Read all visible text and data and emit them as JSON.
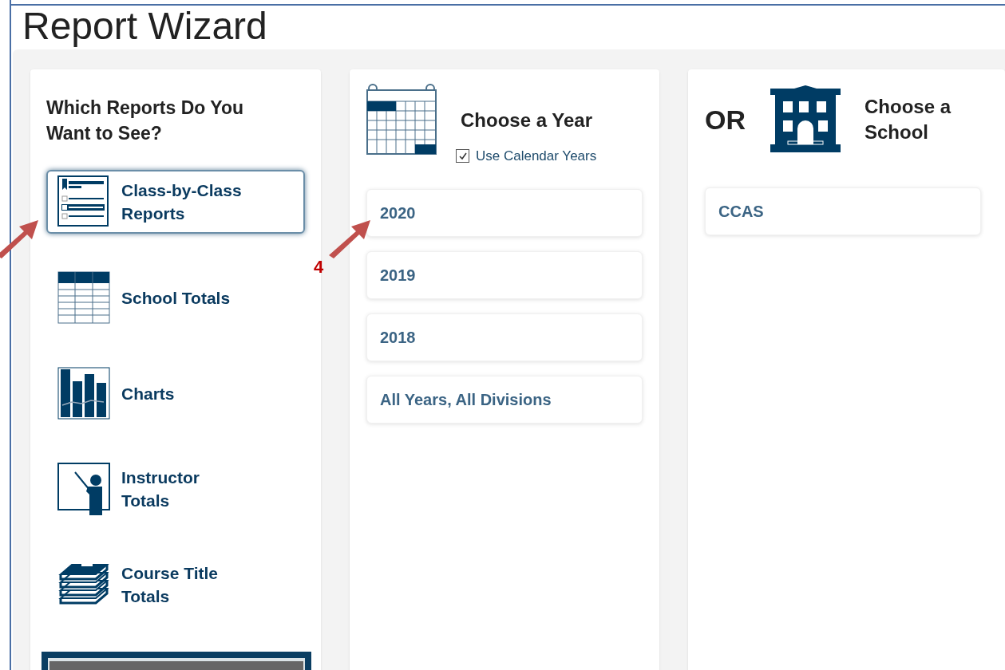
{
  "title": "Report Wizard",
  "reports": {
    "heading": "Which Reports Do You Want to See?",
    "items": [
      {
        "label": "Class-by-Class Reports",
        "kind": "checklist",
        "selected": true
      },
      {
        "label": "School Totals",
        "kind": "table",
        "selected": false
      },
      {
        "label": "Charts",
        "kind": "chart",
        "selected": false
      },
      {
        "label": "Instructor Totals",
        "kind": "instructor",
        "selected": false
      },
      {
        "label": "Course Title Totals",
        "kind": "books",
        "selected": false
      }
    ]
  },
  "years": {
    "heading": "Choose a Year",
    "calendar_option": {
      "label": "Use Calendar Years",
      "checked": true
    },
    "items": [
      {
        "label": "2020",
        "selected": false
      },
      {
        "label": "2019",
        "selected": false
      },
      {
        "label": "2018",
        "selected": false
      },
      {
        "label": "All Years, All Divisions",
        "selected": false
      }
    ]
  },
  "schools": {
    "or_label": "OR",
    "heading": "Choose a School",
    "items": [
      {
        "label": "CCAS",
        "selected": false
      }
    ]
  },
  "annotations": [
    {
      "kind": "arrow"
    },
    {
      "kind": "arrow",
      "label": "4"
    }
  ]
}
